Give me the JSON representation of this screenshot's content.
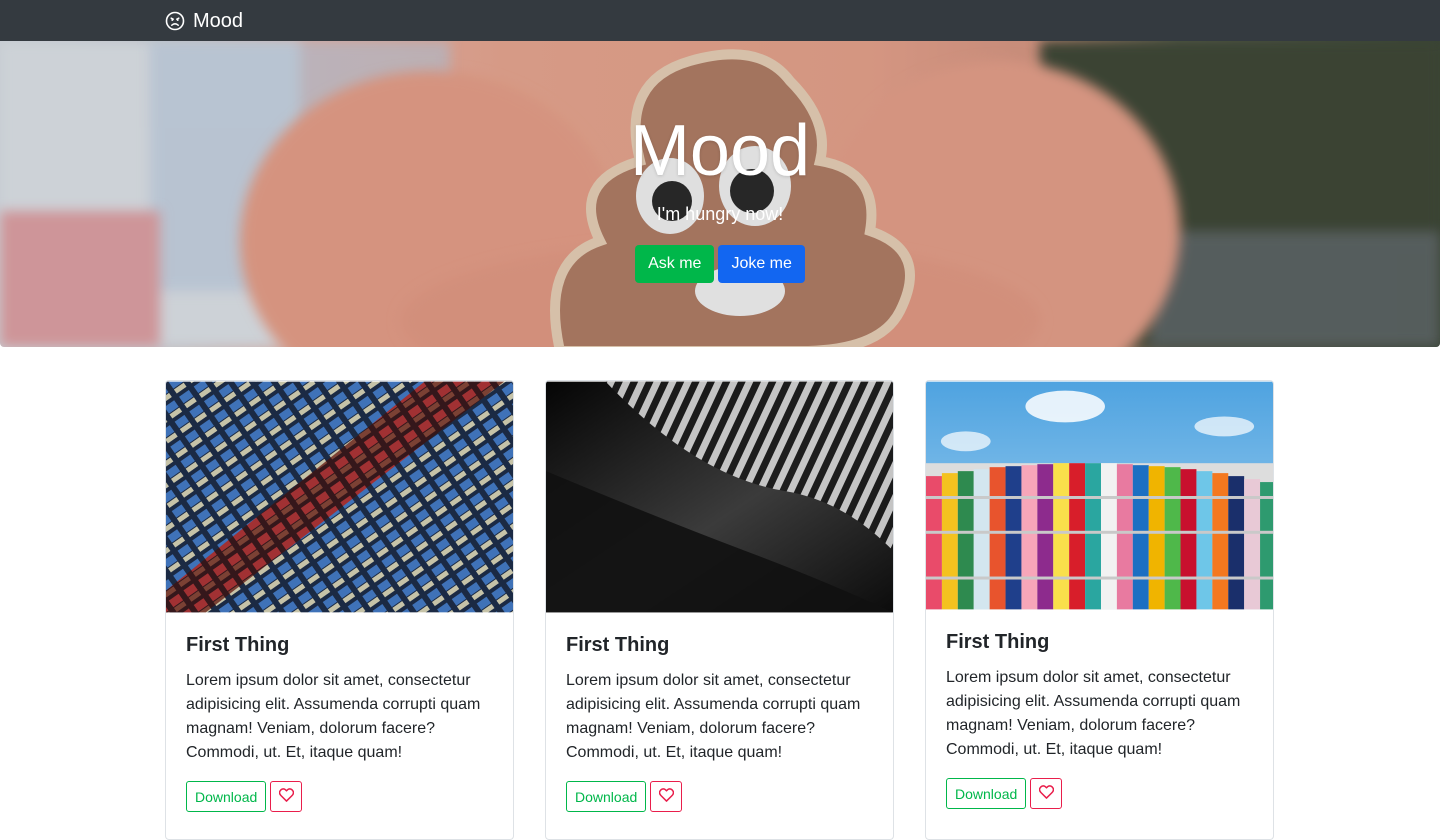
{
  "navbar": {
    "brand_label": "Mood",
    "brand_icon": "sad-face-icon"
  },
  "hero": {
    "title": "Mood",
    "subtitle": "I'm hungry now!",
    "ask_label": "Ask me",
    "joke_label": "Joke me"
  },
  "cards": [
    {
      "title": "First Thing",
      "text": "Lorem ipsum dolor sit amet, consectetur adipisicing elit. Assumenda corrupti quam magnam! Veniam, dolorum facere? Commodi, ut. Et, itaque quam!",
      "download_label": "Download",
      "image": "building-facade-photo"
    },
    {
      "title": "First Thing",
      "text": "Lorem ipsum dolor sit amet, consectetur adipisicing elit. Assumenda corrupti quam magnam! Veniam, dolorum facere? Commodi, ut. Et, itaque quam!",
      "download_label": "Download",
      "image": "abstract-architecture-photo"
    },
    {
      "title": "First Thing",
      "text": "Lorem ipsum dolor sit amet, consectetur adipisicing elit. Assumenda corrupti quam magnam! Veniam, dolorum facere? Commodi, ut. Et, itaque quam!",
      "download_label": "Download",
      "image": "colorful-facade-photo"
    }
  ],
  "colors": {
    "navbar": "#343a40",
    "success": "#00b74a",
    "primary": "#1266f1",
    "danger": "#e91e4b"
  }
}
